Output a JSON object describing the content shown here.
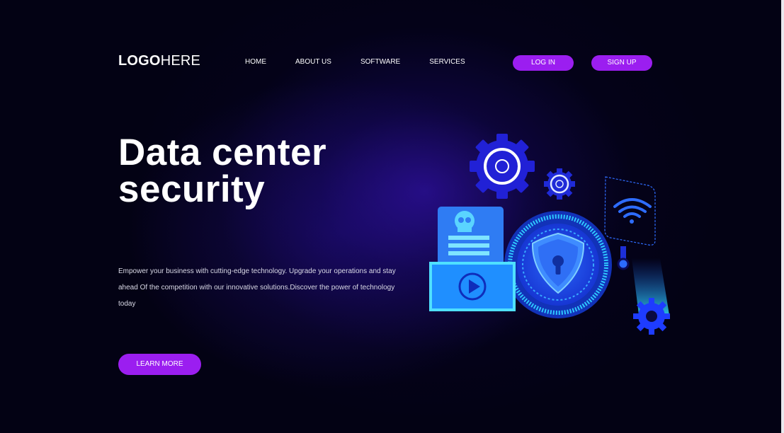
{
  "logo": {
    "bold": "LOGO",
    "thin": "HERE"
  },
  "nav": {
    "items": [
      "HOME",
      "ABOUT US",
      "SOFTWARE",
      "SERVICES"
    ]
  },
  "auth": {
    "login": "LOG IN",
    "signup": "SIGN UP"
  },
  "hero": {
    "title_line1": "Data center",
    "title_line2": "security",
    "description": "Empower your business with cutting-edge technology. Upgrade your operations and stay ahead Of the competition with our innovative solutions.Discover the power of technology today",
    "cta": "LEARN MORE"
  },
  "colors": {
    "accent": "#9b1ef0",
    "background": "#030214",
    "glow": "#3a14c8",
    "cyan": "#29c7ff",
    "blue": "#2a2cff"
  },
  "illustration": {
    "icons": [
      "gear-icon",
      "shield-lock-icon",
      "skull-document-icon",
      "video-play-icon",
      "wifi-icon"
    ]
  }
}
